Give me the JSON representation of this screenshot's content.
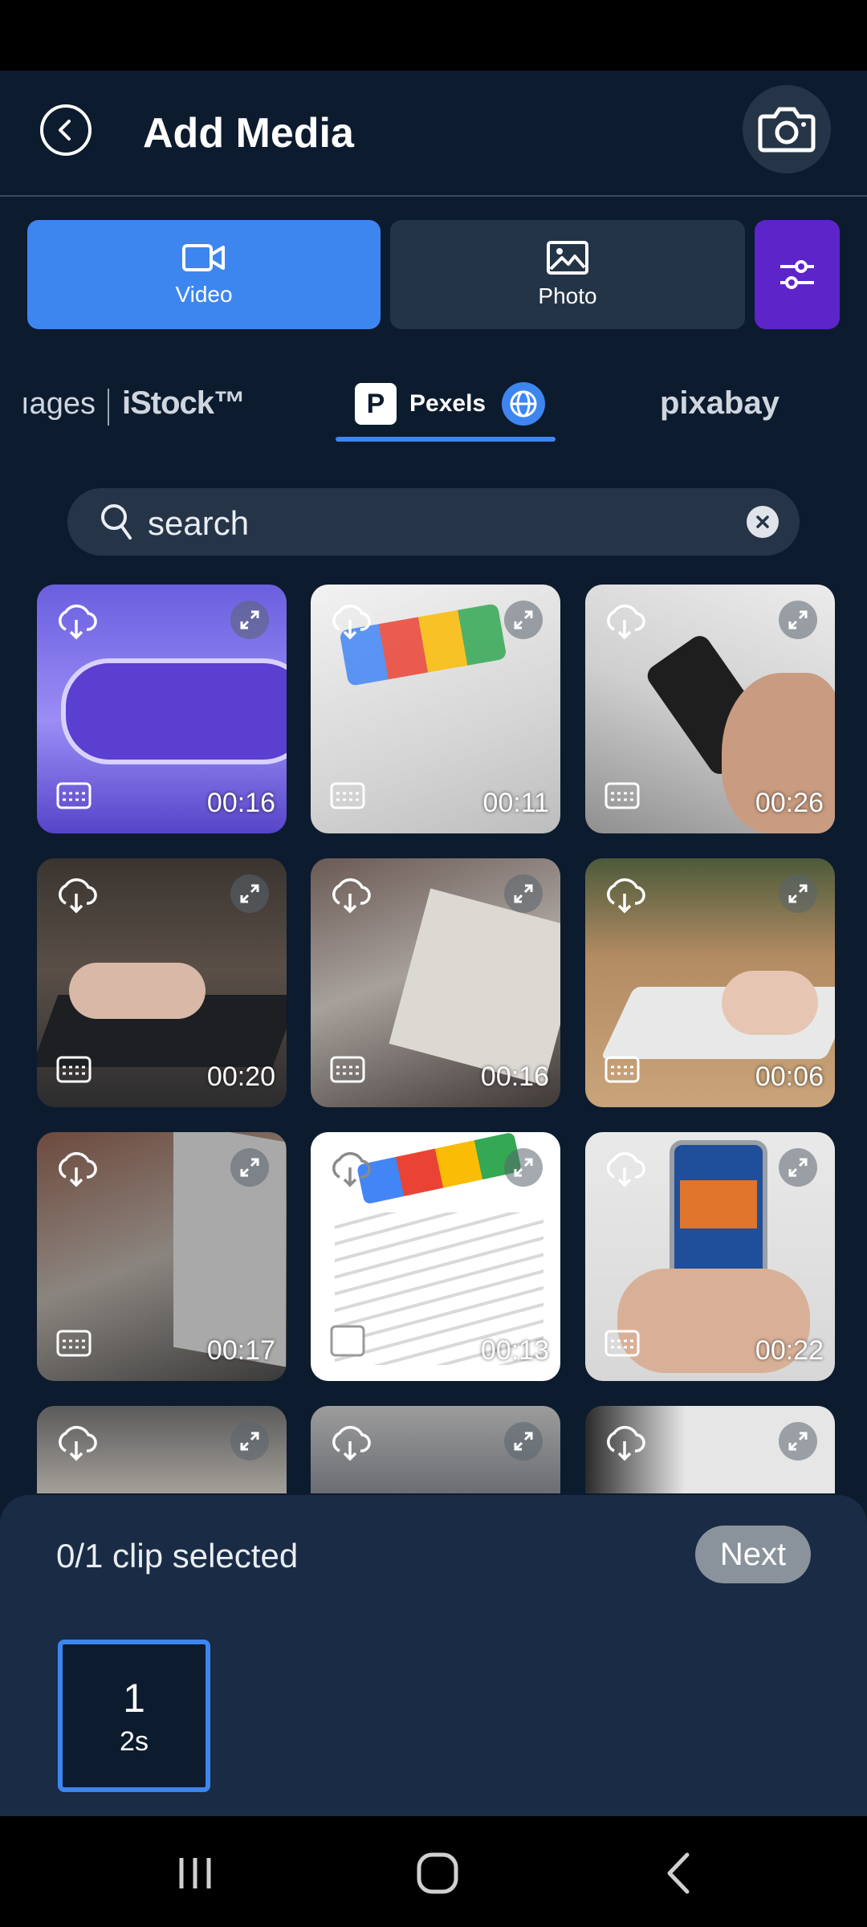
{
  "header": {
    "title": "Add Media"
  },
  "tabs": [
    {
      "label": "Video",
      "icon": "video-camera-icon",
      "active": true
    },
    {
      "label": "Photo",
      "icon": "image-icon",
      "active": false
    }
  ],
  "sources": {
    "getty": "ıages",
    "istock": "iStock™",
    "pexels": "Pexels",
    "pexels_logo": "P",
    "pixabay": "pixabay",
    "active": "Pexels"
  },
  "search": {
    "value": "search"
  },
  "tiles": [
    {
      "duration": "00:16",
      "thumb": "purple-search-bar"
    },
    {
      "duration": "00:11",
      "thumb": "google-homepage"
    },
    {
      "duration": "00:26",
      "thumb": "hands-phone"
    },
    {
      "duration": "00:20",
      "thumb": "hand-laptop"
    },
    {
      "duration": "00:16",
      "thumb": "newspaper"
    },
    {
      "duration": "00:06",
      "thumb": "keyboard-typing"
    },
    {
      "duration": "00:17",
      "thumb": "person-laptop"
    },
    {
      "duration": "00:13",
      "thumb": "google-search-list"
    },
    {
      "duration": "00:22",
      "thumb": "phone-news"
    },
    {
      "duration": "",
      "thumb": "food-website"
    },
    {
      "duration": "",
      "thumb": "laptop-news"
    },
    {
      "duration": "",
      "thumb": "browser-screen"
    }
  ],
  "selection": {
    "status": "0/1 clip selected",
    "next_label": "Next"
  },
  "clip_slot": {
    "number": "1",
    "duration": "2s"
  },
  "colors": {
    "accent": "#3d86f0",
    "filter": "#5d24c9",
    "background": "#0d1b2e"
  }
}
